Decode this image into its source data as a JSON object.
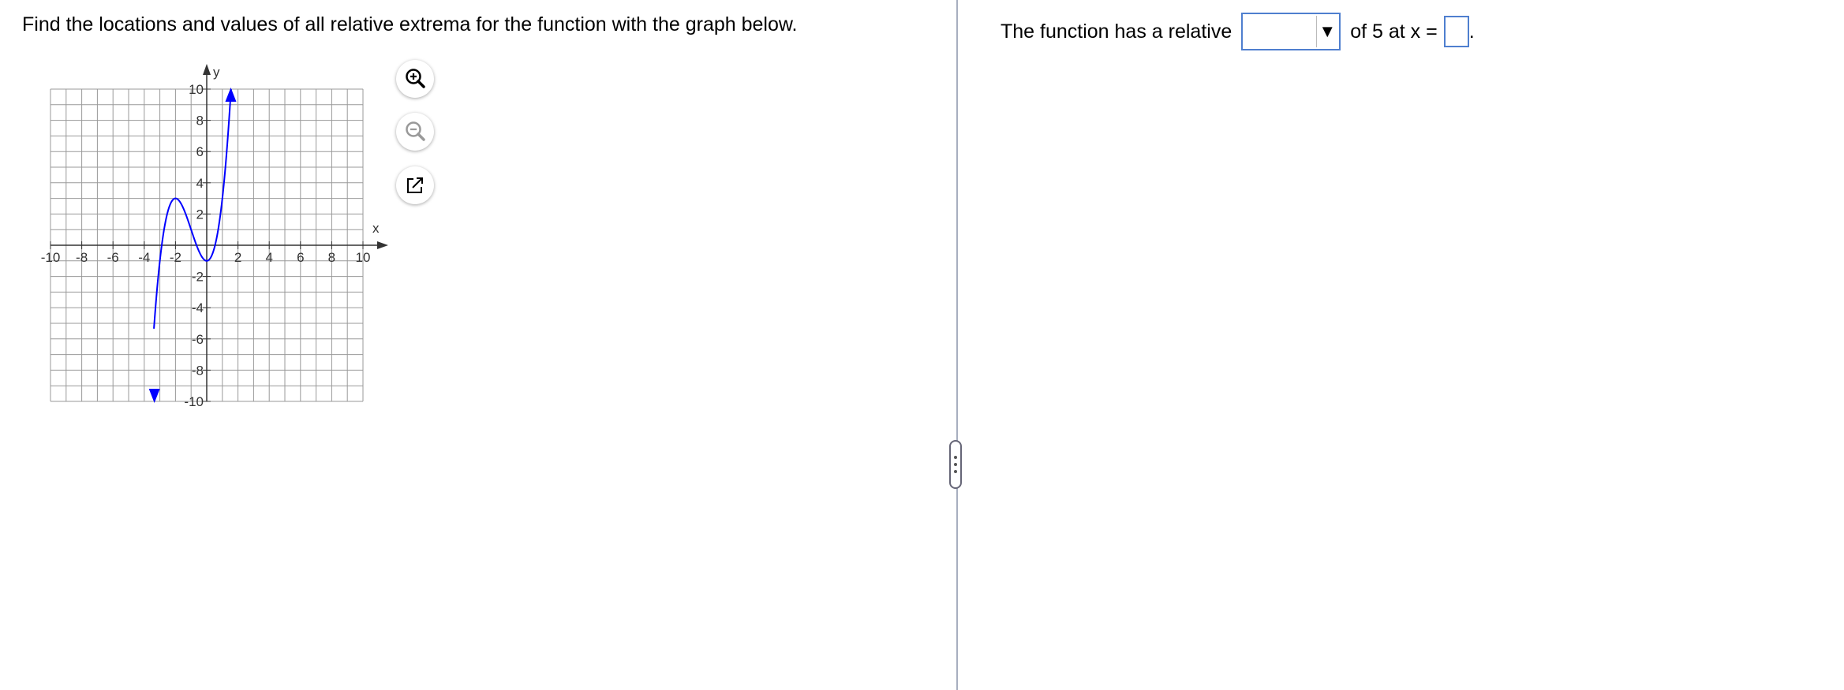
{
  "question": {
    "text": "Find the locations and values of all relative extrema for the function with the graph below."
  },
  "graph": {
    "x_axis_label": "x",
    "y_axis_label": "y",
    "x_ticks": [
      "-10",
      "-8",
      "-6",
      "-4",
      "-2",
      "2",
      "4",
      "6",
      "8",
      "10"
    ],
    "y_ticks": [
      "10",
      "8",
      "6",
      "4",
      "2",
      "-2",
      "-4",
      "-6",
      "-8",
      "-10"
    ],
    "xlim": [
      -10,
      10
    ],
    "ylim": [
      -10,
      10
    ],
    "curve_color": "#0000ff"
  },
  "tools": {
    "zoom_in": "zoom-in-icon",
    "zoom_out": "zoom-out-icon",
    "popout": "popout-icon"
  },
  "answer": {
    "prefix": "The function has a relative",
    "dropdown_value": "",
    "middle": "of 5 at x =",
    "x_value": "",
    "suffix": "."
  },
  "colors": {
    "input_border": "#4f7fcf",
    "divider": "#a7aebf"
  }
}
